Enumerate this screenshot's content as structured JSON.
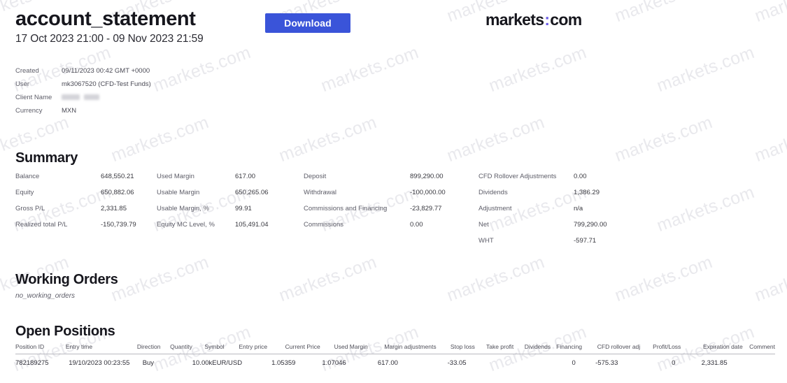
{
  "header": {
    "title": "account_statement",
    "date_range": "17 Oct 2023 21:00 - 09 Nov 2023 21:59",
    "download_label": "Download",
    "logo_left": "markets",
    "logo_colon": ":",
    "logo_right": "com"
  },
  "meta": [
    {
      "label": "Created",
      "value": "09/11/2023 00:42 GMT +0000",
      "redacted": false
    },
    {
      "label": "User",
      "value": "mk3067520 (CFD-Test Funds)",
      "redacted": false
    },
    {
      "label": "Client Name",
      "value": "",
      "redacted": true
    },
    {
      "label": "Currency",
      "value": "MXN",
      "redacted": false
    }
  ],
  "summary": {
    "title": "Summary",
    "columns": [
      [
        {
          "label": "Balance",
          "value": "648,550.21"
        },
        {
          "label": "Equity",
          "value": "650,882.06"
        },
        {
          "label": "Gross P/L",
          "value": "2,331.85"
        },
        {
          "label": "Realized total P/L",
          "value": "-150,739.79"
        }
      ],
      [
        {
          "label": "Used Margin",
          "value": "617.00"
        },
        {
          "label": "Usable Margin",
          "value": "650,265.06"
        },
        {
          "label": "Usable Margin, %",
          "value": "99.91"
        },
        {
          "label": "Equity MC Level, %",
          "value": "105,491.04"
        }
      ],
      [
        {
          "label": "Deposit",
          "value": "899,290.00"
        },
        {
          "label": "Withdrawal",
          "value": "-100,000.00"
        },
        {
          "label": "Commissions and Financing",
          "value": "-23,829.77"
        },
        {
          "label": "Commissions",
          "value": "0.00"
        }
      ],
      [
        {
          "label": "CFD Rollover Adjustments",
          "value": "0.00"
        },
        {
          "label": "Dividends",
          "value": "1,386.29"
        },
        {
          "label": "Adjustment",
          "value": "n/a"
        },
        {
          "label": "Net",
          "value": "799,290.00"
        },
        {
          "label": "WHT",
          "value": "-597.71"
        }
      ]
    ]
  },
  "working_orders": {
    "title": "Working Orders",
    "empty_text": "no_working_orders"
  },
  "open_positions": {
    "title": "Open Positions",
    "headers": [
      "Position ID",
      "Entry time",
      "Direction",
      "Quantity",
      "Symbol",
      "Entry price",
      "Current Price",
      "Used Margin",
      "Margin adjustments",
      "Stop loss",
      "Take profit",
      "Dividends",
      "Financing",
      "CFD rollover adj",
      "Profit/Loss",
      "Expiration date",
      "Comment"
    ],
    "rows": [
      {
        "position_id": "782189275",
        "entry_time": "19/10/2023 00:23:55",
        "direction": "Buy",
        "quantity": "10.00k",
        "symbol": "EUR/USD",
        "entry_price": "1.05359",
        "current_price": "1.07046",
        "used_margin": "617.00",
        "margin_adjustments": "-33.05",
        "stop_loss": "",
        "take_profit": "",
        "dividends": "0",
        "financing": "-575.33",
        "cfd_rollover_adj": "0",
        "profit_loss": "2,331.85",
        "expiration_date": "",
        "comment": ""
      }
    ]
  },
  "watermark": {
    "text": "markets.com"
  }
}
